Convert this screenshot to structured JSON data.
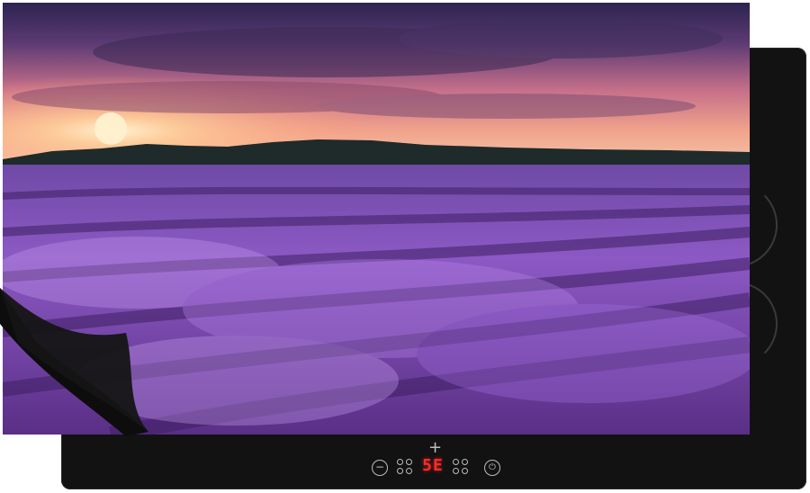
{
  "hob": {
    "display_text": "5E",
    "colors": {
      "hob": "#121212",
      "display": "#ff2b2b"
    },
    "icons": [
      "plus-icon",
      "minus-icon",
      "dots-icon",
      "power-icon"
    ]
  },
  "scene": {
    "colors": {
      "sky_top": "#3a2c57",
      "sun": "#ffd7a0",
      "lavender": "#8f5cc7",
      "mountain": "#1f2a2a"
    }
  }
}
